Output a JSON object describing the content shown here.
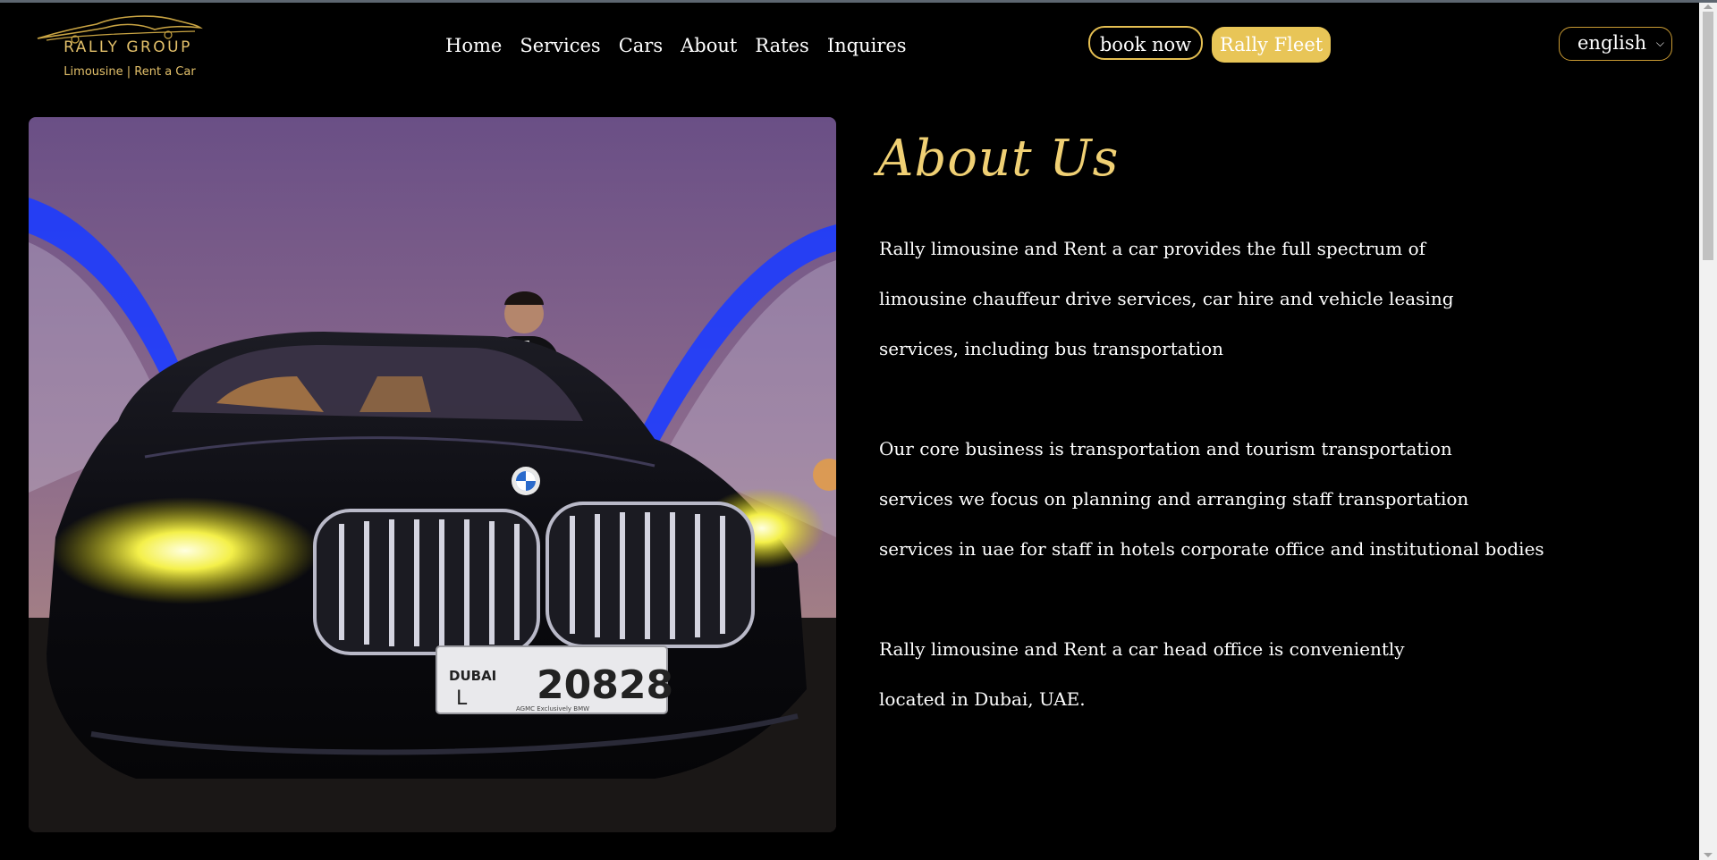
{
  "brand": {
    "name": "RALLY GROUP",
    "tagline": "Limousine | Rent a Car"
  },
  "nav": {
    "items": [
      "Home",
      "Services",
      "Cars",
      "About",
      "Rates",
      "Inquires"
    ]
  },
  "header": {
    "book_label": "book now",
    "fleet_label": "Rally Fleet",
    "language": "english"
  },
  "about": {
    "title": "About Us",
    "p1": [
      "Rally limousine and Rent a car provides the full spectrum of",
      "limousine chauffeur drive services, car hire and vehicle leasing",
      "services, including bus transportation"
    ],
    "p2": [
      "Our core business is transportation and tourism transportation",
      "services we focus on planning and arranging staff transportation",
      "services in uae for staff in hotels corporate office and institutional bodies"
    ],
    "p3": [
      "Rally limousine and Rent a car head office is conveniently",
      "located in Dubai, UAE."
    ]
  },
  "photo": {
    "plate_city": "DUBAI",
    "plate_letter": "L",
    "plate_number": "20828",
    "plate_footer": "AGMC   Exclusively   BMW"
  },
  "colors": {
    "gold": "#e8c557",
    "title_gold": "#f0d074",
    "background": "#000000"
  }
}
